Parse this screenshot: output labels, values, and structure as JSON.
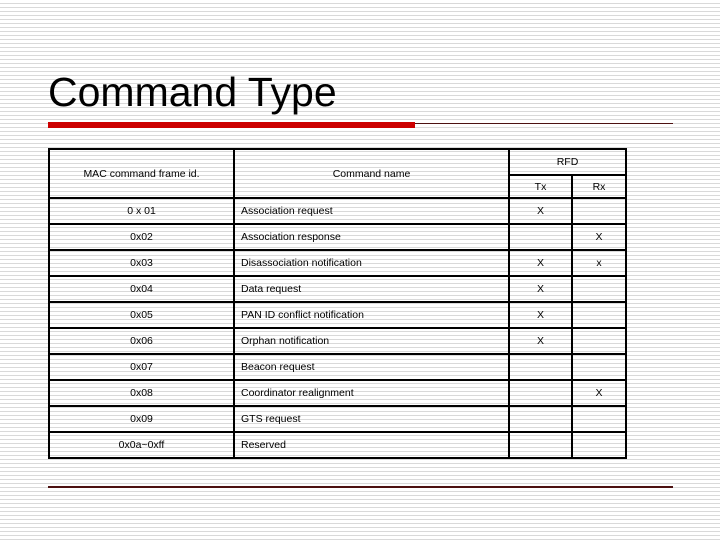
{
  "slide": {
    "title": "Command Type",
    "accent_color": "#cc0000",
    "rule_color": "#4d1111"
  },
  "table": {
    "headers": {
      "id": "MAC command frame id.",
      "name": "Command name",
      "rfd": "RFD",
      "tx": "Tx",
      "rx": "Rx"
    },
    "rows": [
      {
        "id": "0 x 01",
        "name": "Association request",
        "tx": "X",
        "rx": ""
      },
      {
        "id": "0x02",
        "name": "Association response",
        "tx": "",
        "rx": "X"
      },
      {
        "id": "0x03",
        "name": "Disassociation notification",
        "tx": "X",
        "rx": "x"
      },
      {
        "id": "0x04",
        "name": "Data request",
        "tx": "X",
        "rx": ""
      },
      {
        "id": "0x05",
        "name": "PAN ID conflict notification",
        "tx": "X",
        "rx": ""
      },
      {
        "id": "0x06",
        "name": "Orphan notification",
        "tx": "X",
        "rx": ""
      },
      {
        "id": "0x07",
        "name": "Beacon request",
        "tx": "",
        "rx": ""
      },
      {
        "id": "0x08",
        "name": "Coordinator realignment",
        "tx": "",
        "rx": "X"
      },
      {
        "id": "0x09",
        "name": "GTS request",
        "tx": "",
        "rx": ""
      },
      {
        "id": "0x0a~0xff",
        "name": "Reserved",
        "tx": "",
        "rx": ""
      }
    ]
  }
}
